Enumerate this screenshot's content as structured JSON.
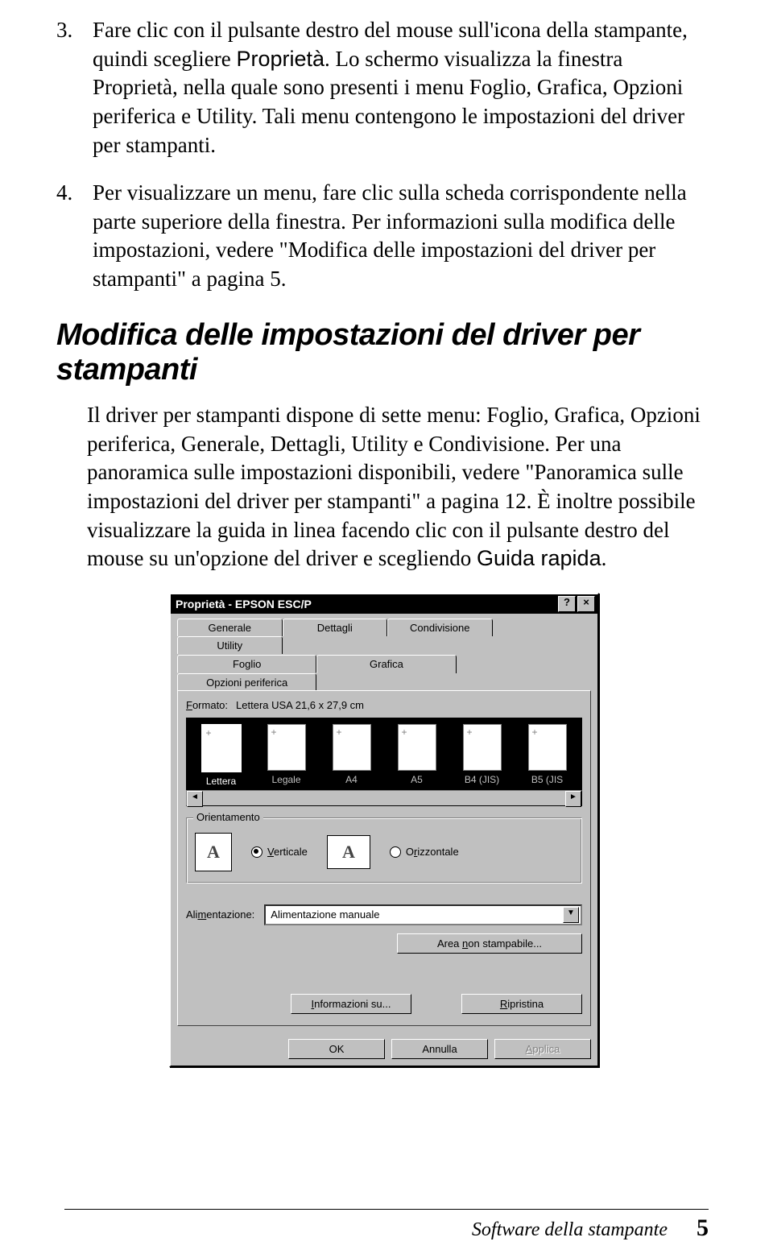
{
  "list": {
    "item3": {
      "num": "3.",
      "text_a": "Fare clic con il pulsante destro del mouse sull'icona della stampante, quindi scegliere ",
      "proprieta": "Proprietà",
      "text_b": ". Lo schermo visualizza la finestra Proprietà, nella quale sono presenti i menu Foglio, Grafica, Opzioni periferica e Utility. Tali menu contengono le impostazioni del driver per stampanti."
    },
    "item4": {
      "num": "4.",
      "text": "Per visualizzare un menu, fare clic sulla scheda corrispondente nella parte superiore della finestra. Per informazioni sulla modifica delle impostazioni, vedere \"Modifica delle impostazioni del driver per stampanti\" a pagina 5."
    }
  },
  "heading": "Modifica delle impostazioni del driver per stampanti",
  "para_a": "Il driver per stampanti dispone di sette menu: Foglio, Grafica, Opzioni periferica, Generale, Dettagli, Utility e Condivisione. Per una panoramica sulle impostazioni disponibili, vedere \"Panoramica sulle impostazioni del driver per stampanti\" a pagina 12. È inoltre possibile visualizzare la guida in linea facendo clic con il pulsante destro del mouse su un'opzione del driver e scegliendo ",
  "guida": "Guida rapida",
  "para_b": ".",
  "dialog": {
    "title": "Proprietà - EPSON           ESC/P",
    "help_btn": "?",
    "close_btn": "×",
    "tabs_back": [
      "Generale",
      "Dettagli",
      "Condivisione",
      "Utility"
    ],
    "tabs_front": [
      "Foglio",
      "Grafica",
      "Opzioni periferica"
    ],
    "format_label": "Formato:",
    "format_value": "Lettera USA 21,6 x 27,9 cm",
    "papers": [
      "Lettera",
      "Legale",
      "A4",
      "A5",
      "B4 (JIS)",
      "B5 (JIS"
    ],
    "orientation": {
      "legend": "Orientamento",
      "opt1": "Verticale",
      "opt2": "Orizzontale",
      "glyph": "A"
    },
    "feed_label": "Alimentazione:",
    "feed_value": "Alimentazione manuale",
    "area_btn": "Area non stampabile...",
    "info_btn": "Informazioni su...",
    "restore_btn": "Ripristina",
    "ok": "OK",
    "cancel": "Annulla",
    "apply": "Applica"
  },
  "footer": {
    "label": "Software della stampante",
    "page": "5"
  }
}
